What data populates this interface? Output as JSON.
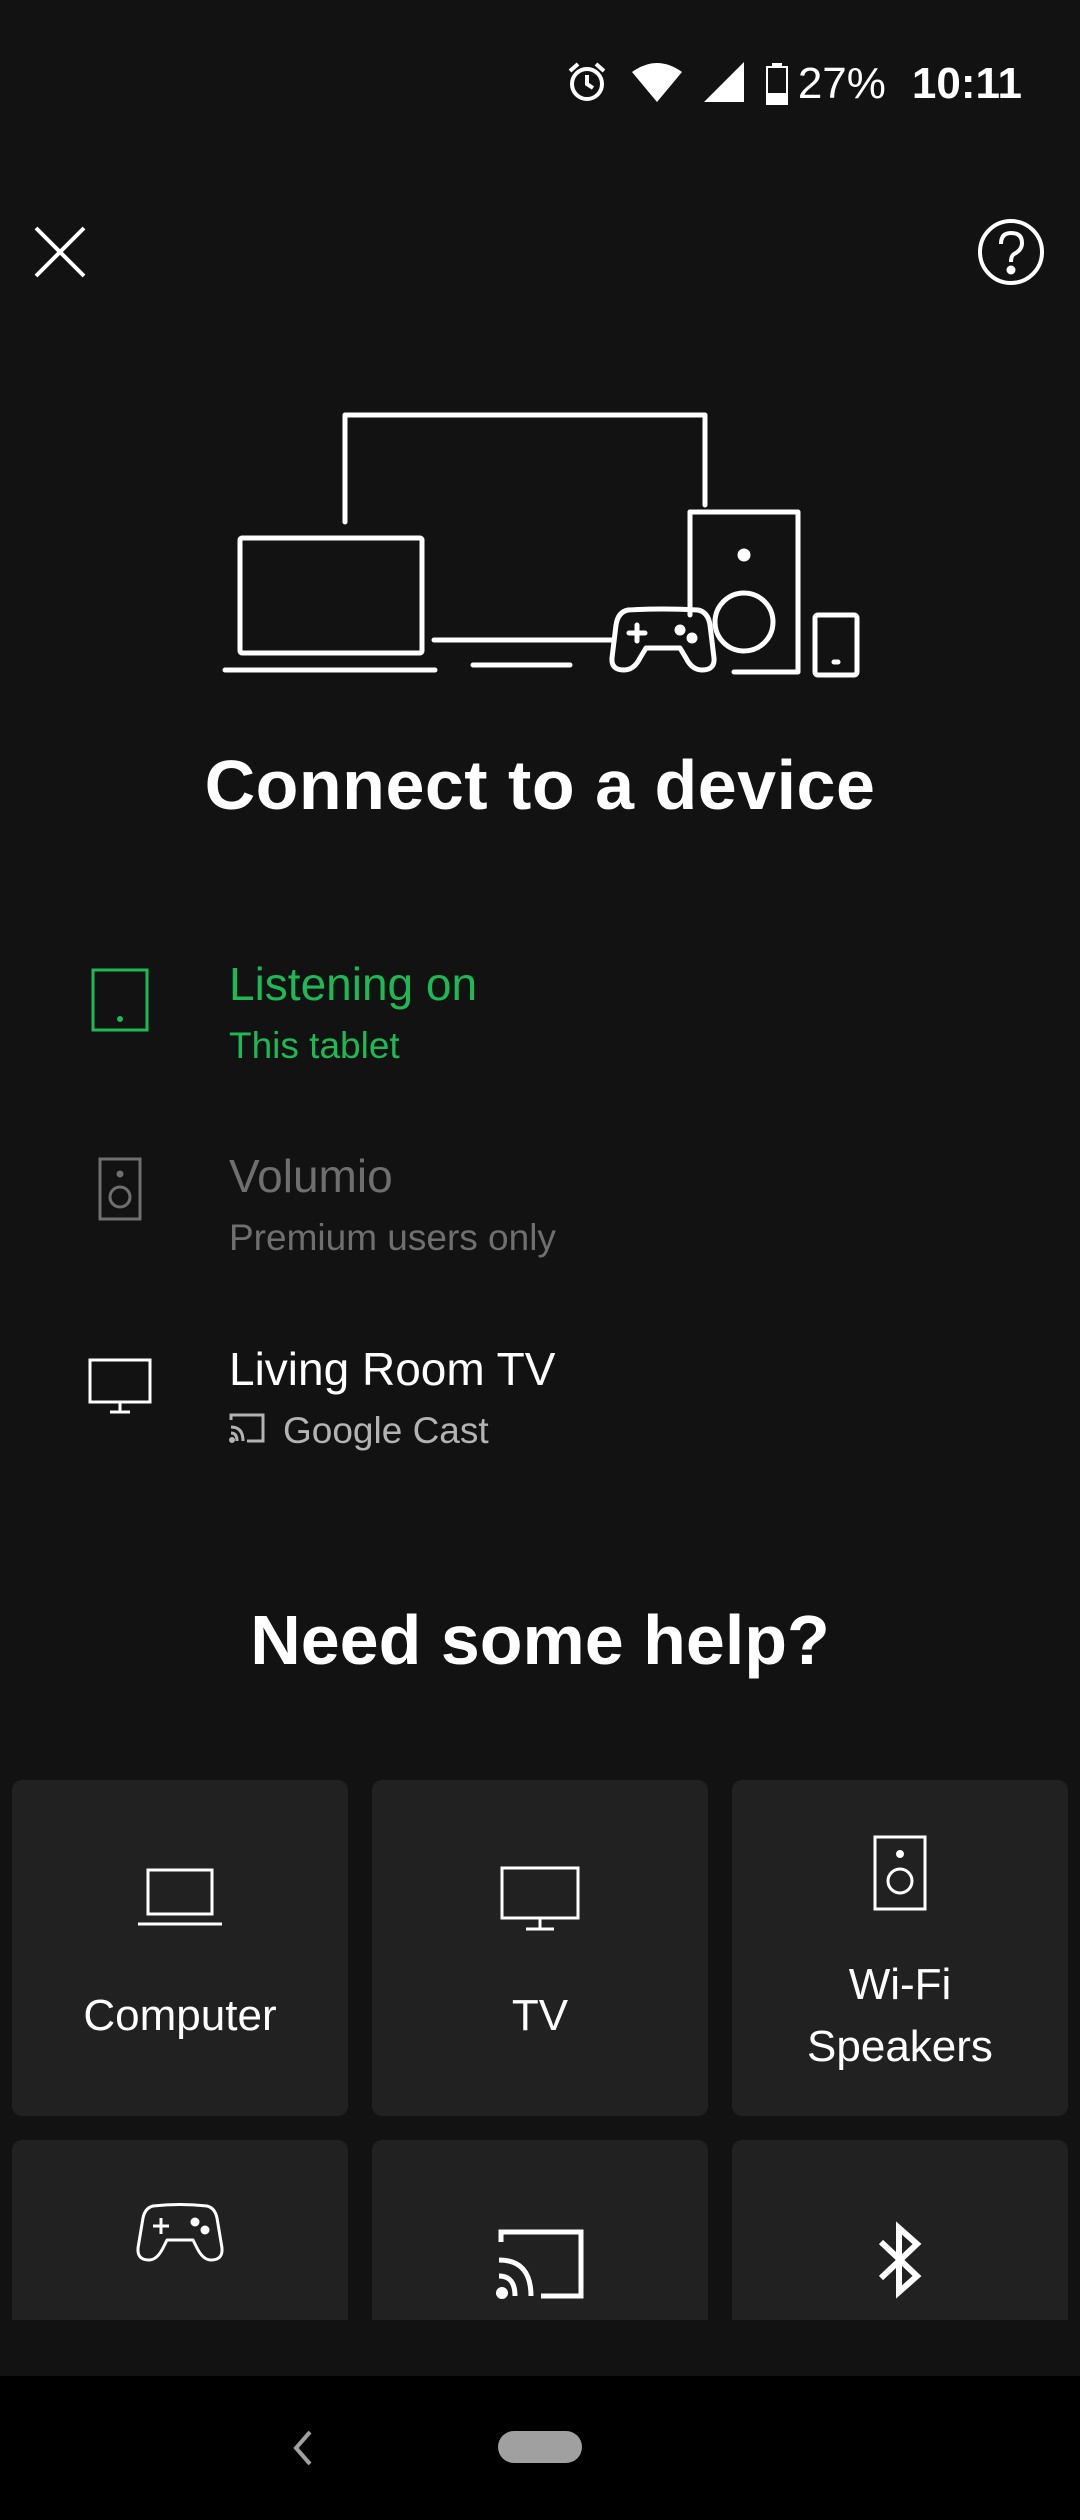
{
  "status_bar": {
    "battery_percent": "27%",
    "time": "10:11",
    "icons": [
      "alarm-icon",
      "wifi-icon",
      "cellular-signal-icon",
      "battery-icon"
    ]
  },
  "header": {
    "close_icon": "close-icon",
    "help_icon": "help-icon"
  },
  "hero": {
    "icon": "devices-illustration",
    "title": "Connect to a device"
  },
  "devices": [
    {
      "name": "Listening on",
      "subtitle": "This tablet",
      "icon": "tablet-icon",
      "color": "#1db954"
    },
    {
      "name": "Volumio",
      "subtitle": "Premium users only",
      "icon": "speaker-icon",
      "color": "#6f6f6f"
    },
    {
      "name": "Living Room TV",
      "subtitle": "Google Cast",
      "icon": "tv-icon",
      "sub_icon": "cast-icon"
    }
  ],
  "help": {
    "title": "Need some help?",
    "tiles": [
      {
        "label": "Computer",
        "icon": "laptop-icon"
      },
      {
        "label": "TV",
        "icon": "tv-icon"
      },
      {
        "label": "Wi-Fi Speakers",
        "line1": "Wi-Fi",
        "line2": "Speakers",
        "icon": "speaker-icon"
      },
      {
        "label": "",
        "icon": "gamepad-icon"
      },
      {
        "label": "",
        "icon": "cast-icon"
      },
      {
        "label": "",
        "icon": "bluetooth-icon"
      }
    ]
  },
  "colors": {
    "accent": "#1db954",
    "background": "#121212",
    "tile": "#212121"
  }
}
